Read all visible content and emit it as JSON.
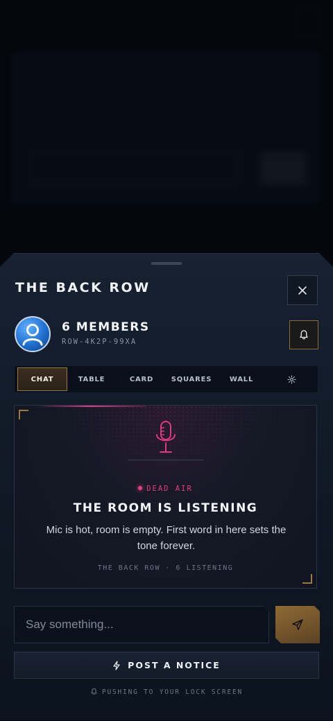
{
  "background": {
    "eyebrow": "",
    "title": "",
    "card_kicker": "",
    "card_heading": "",
    "card_body": "",
    "card_field": "",
    "section_label": ""
  },
  "sheet": {
    "title": "THE BACK ROW",
    "members_label": "6 MEMBERS",
    "room_code": "ROW-4K2P-99XA",
    "tabs": [
      {
        "label": "CHAT",
        "active": true
      },
      {
        "label": "TABLE",
        "active": false
      },
      {
        "label": "CARD",
        "active": false
      },
      {
        "label": "SQUARES",
        "active": false
      },
      {
        "label": "WALL",
        "active": false
      }
    ],
    "empty_state": {
      "status": "DEAD AIR",
      "heading": "THE ROOM IS LISTENING",
      "body": "Mic is hot, room is empty. First word in here sets the tone forever.",
      "footer": "THE BACK ROW · 6 LISTENING"
    },
    "composer": {
      "placeholder": "Say something...",
      "value": ""
    },
    "notice_button": "POST A NOTICE",
    "push_hint": "PUSHING TO YOUR LOCK SCREEN"
  },
  "colors": {
    "accent_gold": "#9a7740",
    "accent_pink": "#e3407f",
    "sheet_bg": "#111a27"
  },
  "icons": {
    "close": "close-icon",
    "bell": "bell-icon",
    "settings": "gear-icon",
    "mic": "microphone-icon",
    "send": "send-icon",
    "bolt": "bolt-icon"
  }
}
